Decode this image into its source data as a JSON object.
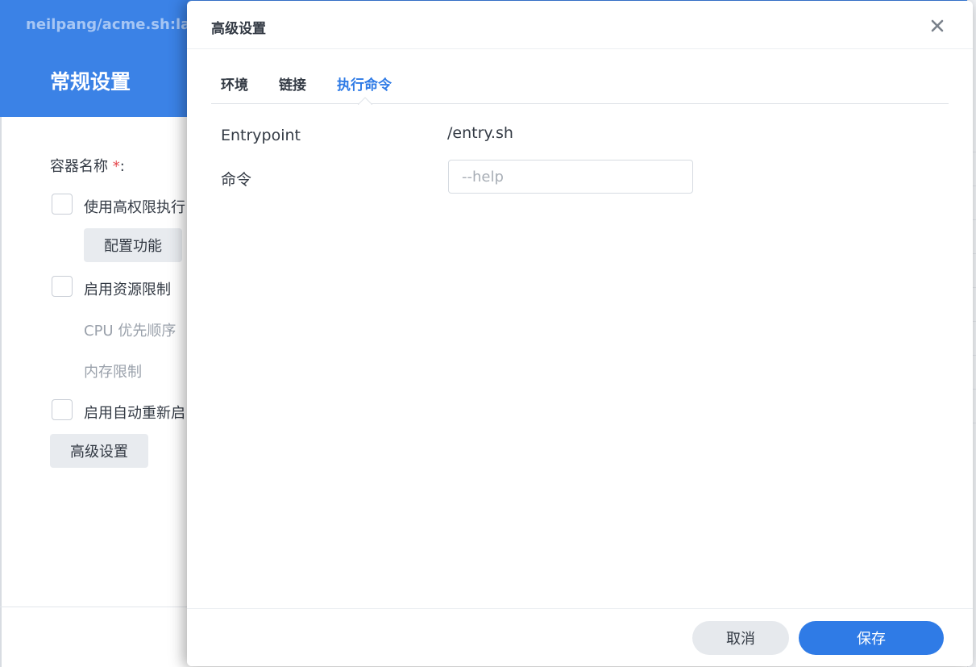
{
  "background": {
    "window_title": "neilpang/acme.sh:la",
    "section_title": "常规设置",
    "container_name_label": "容器名称",
    "required_mark": "*",
    "colon": ":",
    "privilege_label": "使用高权限执行",
    "configure_button": "配置功能",
    "resource_limit_label": "启用资源限制",
    "cpu_priority_label": "CPU 优先顺序",
    "memory_limit_label": "内存限制",
    "auto_restart_label": "启用自动重新启",
    "advanced_button": "高级设置"
  },
  "modal": {
    "title": "高级设置",
    "close_icon": "close-icon",
    "tabs": [
      {
        "label": "环境",
        "active": false
      },
      {
        "label": "链接",
        "active": false
      },
      {
        "label": "执行命令",
        "active": true
      }
    ],
    "entrypoint_label": "Entrypoint",
    "entrypoint_value": "/entry.sh",
    "command_label": "命令",
    "command_value": "",
    "command_placeholder": "--help",
    "cancel_button": "取消",
    "save_button": "保存"
  },
  "colors": {
    "accent": "#2f7be6",
    "header_blue": "#3b82e6",
    "required": "#e5484d"
  }
}
